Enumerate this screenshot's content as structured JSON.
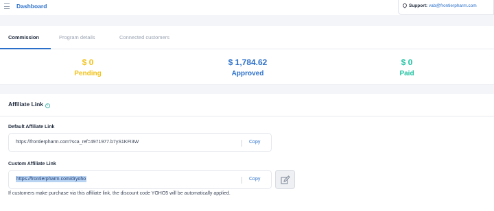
{
  "header": {
    "title": "Dashboard",
    "support_label": "Support:",
    "support_email": "vab@frontierpharm.com"
  },
  "tabs": [
    {
      "label": "Commission",
      "active": true
    },
    {
      "label": "Program details",
      "active": false
    },
    {
      "label": "Connected customers",
      "active": false
    }
  ],
  "stats": [
    {
      "amount": "$ 0",
      "label": "Pending",
      "color": "#f2c21a"
    },
    {
      "amount": "$ 1,784.62",
      "label": "Approved",
      "color": "#2a6fc9"
    },
    {
      "amount": "$ 0",
      "label": "Paid",
      "color": "#1fc2a2"
    }
  ],
  "affiliate": {
    "title": "Affiliate Link",
    "info_icon": "info-icon",
    "default_label": "Default Affiliate Link",
    "default_url": "https://frontierpharm.com?sca_ref=4971977.b7yS1KFI3W",
    "custom_label": "Custom Affiliate Link",
    "custom_url": "https://frontierpharm.com/dryoho",
    "copy_label": "Copy",
    "note": "If customers make purchase via this affiliate link, the discount code YOHO5 will be automatically applied."
  }
}
